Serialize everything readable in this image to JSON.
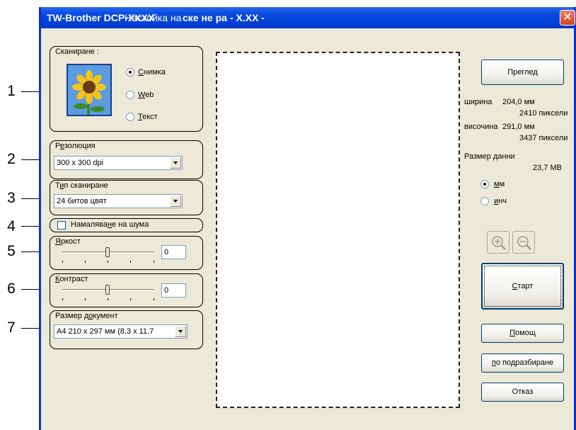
{
  "callouts": [
    "1",
    "2",
    "3",
    "4",
    "5",
    "6",
    "7"
  ],
  "window": {
    "title_app": "TW-Brother DCP-XXXX",
    "title_main": "Настойка на ске не ра - X.XX -",
    "title_part1": "Настойка на",
    "title_part2": "ске не ра - X.XX -"
  },
  "scan": {
    "label": "Сканиране :",
    "options": [
      {
        "pre": "",
        "ul": "С",
        "post": "нимка",
        "checked": true
      },
      {
        "pre": "",
        "ul": "W",
        "post": "eb",
        "checked": false
      },
      {
        "pre": "",
        "ul": "Т",
        "post": "екст",
        "checked": false
      }
    ],
    "opt0_ul": "С",
    "opt0_post": "нимка",
    "opt1_ul": "W",
    "opt1_post": "eb",
    "opt2_ul": "Т",
    "opt2_post": "екст"
  },
  "resolution": {
    "label_pre": "Р",
    "label_ul": "е",
    "label_post": "золюция",
    "value": "300 x 300 dpi"
  },
  "scan_type": {
    "label_pre": "Т",
    "label_ul": "и",
    "label_post": "п сканиране",
    "value": "24 битов цвят"
  },
  "noise": {
    "label_pre": "Намалява",
    "label_ul": "н",
    "label_post": "е на шума",
    "checked": false
  },
  "brightness": {
    "label_ul": "Я",
    "label_post": "ркост",
    "value": "0",
    "level": 0
  },
  "contrast": {
    "label_ul": "К",
    "label_post": "онтраст",
    "value": "0",
    "level": 0
  },
  "doc_size": {
    "label_pre": "Размер д",
    "label_ul": "о",
    "label_post": "кумент",
    "value": "A4 210 x 297 мм (8.3 x 11.7"
  },
  "info": {
    "width_label": "ширина",
    "width_mm": "204,0 мм",
    "width_px": "2410 пиксели",
    "height_label": "височина",
    "height_mm": "291,0 мм",
    "height_px": "3437 пиксели",
    "data_size_label": "Размер данни",
    "data_size": "23,7 MB"
  },
  "units": {
    "mm_ul": "м",
    "mm_post": "м",
    "inch_ul": "и",
    "inch_post": "нч",
    "selected": "mm"
  },
  "buttons": {
    "preview": "Преглед",
    "start_ul": "С",
    "start_post": "тарт",
    "help_ul": "П",
    "help_post": "омощ",
    "default_ul": "п",
    "default_post": "о подразбиране",
    "cancel": "Отказ"
  },
  "icons": {
    "zoom_in": "zoom-in-icon",
    "zoom_out": "zoom-out-icon",
    "close": "close-icon"
  }
}
